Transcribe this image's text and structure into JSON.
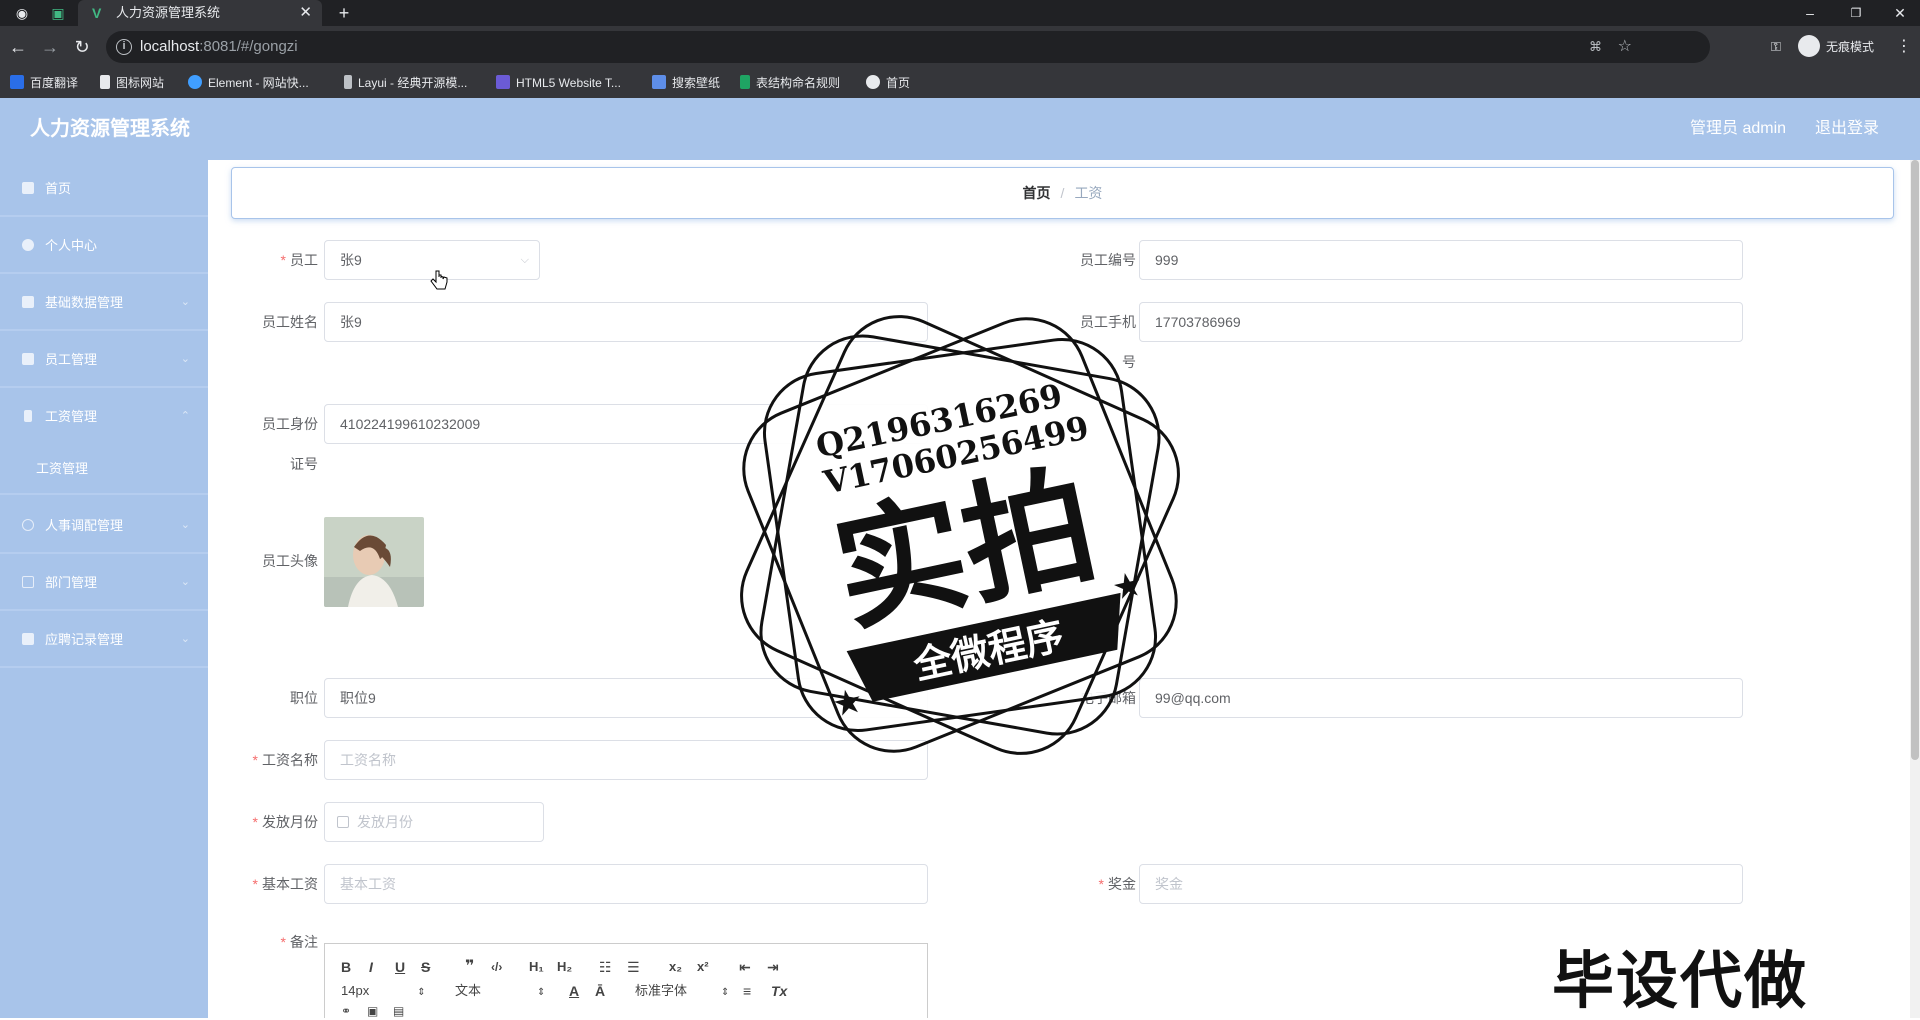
{
  "browser": {
    "tab_title": "人力资源管理系统",
    "url_host": "localhost",
    "url_path": ":8081/#/gongzi",
    "profile_label": "无痕模式",
    "bookmarks": [
      "百度翻译",
      "图标网站",
      "Element - 网站快...",
      "Layui - 经典开源模...",
      "HTML5 Website T...",
      "搜索壁纸",
      "表结构命名规则",
      "首页"
    ]
  },
  "header": {
    "title": "人力资源管理系统",
    "admin": "管理员 admin",
    "logout": "退出登录"
  },
  "sidebar": {
    "items": [
      {
        "label": "首页",
        "icon": "home-icon"
      },
      {
        "label": "个人中心",
        "icon": "user-icon"
      },
      {
        "label": "基础数据管理",
        "icon": "database-icon"
      },
      {
        "label": "员工管理",
        "icon": "staff-icon"
      },
      {
        "label": "工资管理",
        "icon": "salary-icon"
      },
      {
        "label": "人事调配管理",
        "icon": "transfer-icon"
      },
      {
        "label": "部门管理",
        "icon": "department-icon"
      },
      {
        "label": "应聘记录管理",
        "icon": "records-icon"
      }
    ],
    "sub_item": "工资管理"
  },
  "breadcrumb": {
    "home": "首页",
    "separator": "/",
    "current": "工资"
  },
  "form": {
    "employee_label": "员工",
    "employee_value": "张9",
    "employee_no_label": "员工编号",
    "employee_no_value": "999",
    "name_label": "员工姓名",
    "name_value": "张9",
    "phone_label_1": "员工手机",
    "phone_label_2": "号",
    "phone_value": "17703786969",
    "idcard_label_1": "员工身份",
    "idcard_label_2": "证号",
    "idcard_value": "410224199610232009",
    "avatar_label": "员工头像",
    "position_label": "职位",
    "position_value": "职位9",
    "email_label": "电子邮箱",
    "email_value": "99@qq.com",
    "salary_name_label": "工资名称",
    "salary_name_placeholder": "工资名称",
    "month_label": "发放月份",
    "month_placeholder": "发放月份",
    "base_label": "基本工资",
    "base_placeholder": "基本工资",
    "bonus_label": "奖金",
    "bonus_placeholder": "奖金",
    "remark_label": "备注"
  },
  "editor": {
    "size": "14px",
    "text_type": "文本",
    "font": "标准字体"
  },
  "watermark": {
    "line1": "Q2196316269",
    "line2": "V17060256499",
    "big": "实拍",
    "ribbon": "全微程序",
    "corner": "毕设代做"
  }
}
